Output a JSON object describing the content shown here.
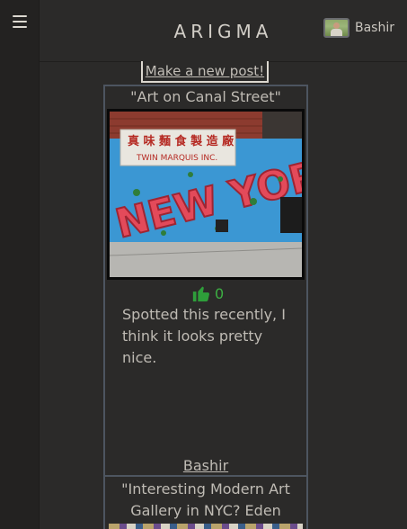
{
  "header": {
    "brand": "ARIGMA",
    "user_name": "Bashir"
  },
  "actions": {
    "new_post": "Make a new post!"
  },
  "posts": [
    {
      "title": "\"Art on Canal Street\"",
      "image_sign_top": "TWIN MARQUIS INC.",
      "image_graffiti": "NEW YORK",
      "likes": "0",
      "body": "Spotted this recently, I think it looks pretty nice.",
      "author": "Bashir"
    },
    {
      "title": "\"Interesting Modern Art Gallery in NYC? Eden Gallery\""
    }
  ],
  "colors": {
    "background": "#2b2a29",
    "card_border": "#4d5560",
    "like_green": "#3cb043"
  }
}
